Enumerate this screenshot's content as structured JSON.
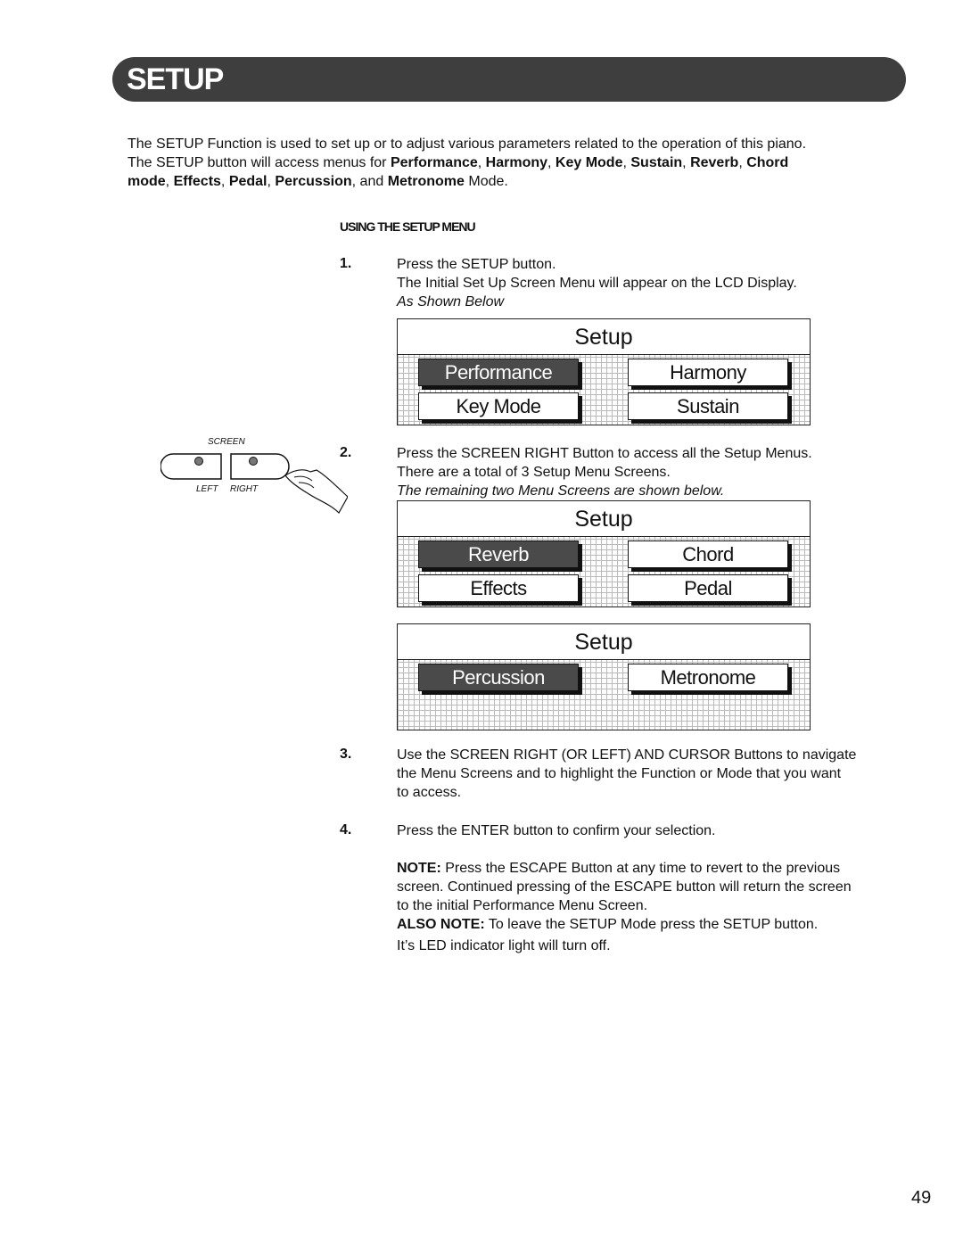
{
  "header": {
    "title": "SETUP"
  },
  "intro": {
    "l1": "The SETUP Function is used to set up or to adjust various parameters related to the operation of this piano.",
    "l2a": "The SETUP button will access menus for ",
    "modes": [
      "Performance",
      "Harmony",
      "Key Mode",
      "Sustain",
      "Reverb",
      "Chord",
      "mode",
      "Effects",
      "Pedal",
      "Percussion",
      "Metronome"
    ],
    "and": "and",
    "mode_end": "Mode."
  },
  "section_heading": "USING THE SETUP MENU",
  "steps": [
    {
      "num": "1.",
      "lines": [
        "Press the SETUP button.",
        "The Initial Set Up Screen Menu will appear on the LCD Display."
      ],
      "caption": "As Shown Below"
    },
    {
      "num": "2.",
      "lines": [
        "Press the SCREEN RIGHT Button to access all the Setup Menus.",
        "There are a total of 3 Setup Menu Screens."
      ],
      "caption": "The remaining two Menu Screens are shown below."
    },
    {
      "num": "3.",
      "lines": [
        "Use the SCREEN RIGHT (OR LEFT) AND CURSOR Buttons to navigate",
        "the Menu Screens and to highlight the Function or Mode that you want",
        "to access."
      ]
    },
    {
      "num": "4.",
      "lines": [
        "Press the ENTER button to confirm your selection."
      ]
    }
  ],
  "screens": [
    {
      "title": "Setup",
      "items": [
        "Performance",
        "Harmony",
        "Key Mode",
        "Sustain"
      ],
      "selected": "Performance"
    },
    {
      "title": "Setup",
      "items": [
        "Reverb",
        "Chord",
        "Effects",
        "Pedal"
      ],
      "selected": "Reverb"
    },
    {
      "title": "Setup",
      "items": [
        "Percussion",
        "Metronome"
      ],
      "selected": "Percussion"
    }
  ],
  "panel": {
    "label": "SCREEN",
    "left": "LEFT",
    "right": "RIGHT"
  },
  "note": {
    "label": "NOTE:",
    "text": " Press the ESCAPE Button at any time to revert to the previous",
    "l2": "screen.  Continued pressing of the ESCAPE button will return the screen",
    "l3": "to the initial Performance Menu Screen.",
    "also_label": "ALSO NOTE:",
    "also_text": " To leave the SETUP Mode press the SETUP button.",
    "l5": "It’s LED indicator light will turn off."
  },
  "page_number": "49"
}
